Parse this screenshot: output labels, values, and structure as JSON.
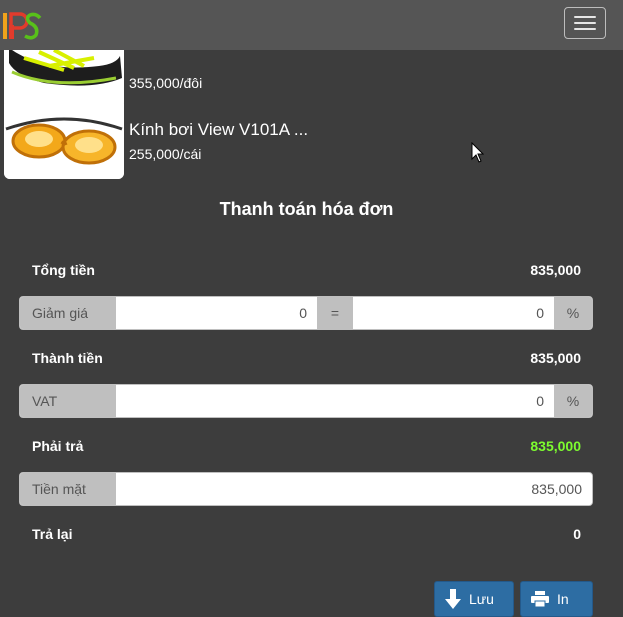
{
  "header": {
    "logo_text": "POS",
    "menu_icon": "hamburger-icon"
  },
  "products": [
    {
      "name": "",
      "price": "355,000/đôi",
      "image": "sneaker-image"
    },
    {
      "name": "Kính bơi View V101A ...",
      "price": "255,000/cái",
      "image": "goggles-image"
    }
  ],
  "payment": {
    "title": "Thanh toán hóa đơn",
    "total_label": "Tổng tiền",
    "total_value": "835,000",
    "discount_label": "Giảm giá",
    "discount_amount": "0",
    "equals": "=",
    "discount_percent": "0",
    "percent_symbol": "%",
    "subtotal_label": "Thành tiền",
    "subtotal_value": "835,000",
    "vat_label": "VAT",
    "vat_value": "0",
    "vat_percent_symbol": "%",
    "due_label": "Phải trả",
    "due_value": "835,000",
    "cash_label": "Tiền mặt",
    "cash_value": "835,000",
    "change_label": "Trả lại",
    "change_value": "0"
  },
  "actions": {
    "save_label": "Lưu",
    "print_label": "In"
  },
  "colors": {
    "background": "#3d3d3d",
    "topbar": "#555555",
    "due_value": "#7dfc2f",
    "button": "#2d6da3",
    "addon": "#bfbfbf"
  }
}
